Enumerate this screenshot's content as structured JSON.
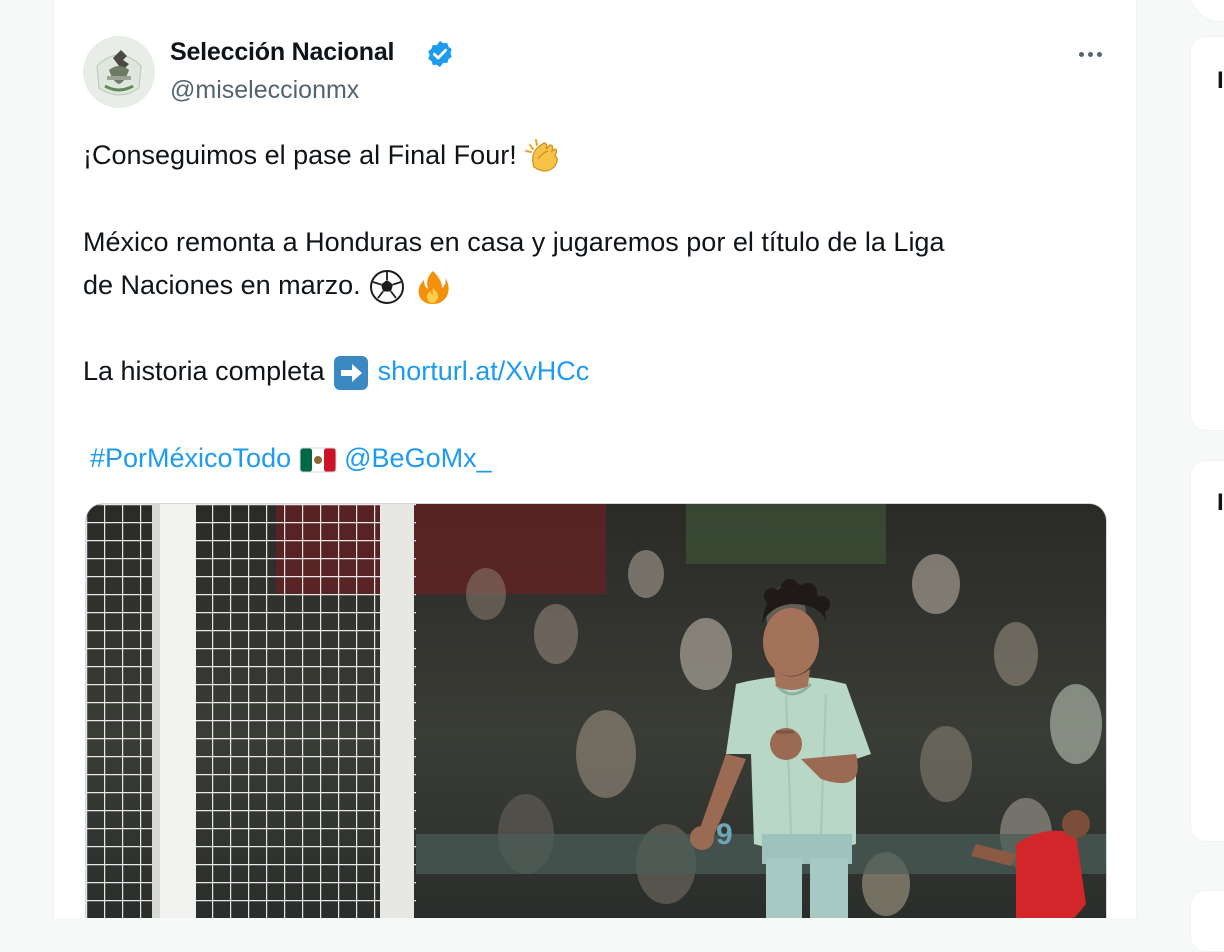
{
  "tweet": {
    "author_name": "Selección Nacional",
    "handle": "@miseleccionmx",
    "lines": {
      "line1": "¡Conseguimos el pase al Final Four!",
      "line2a": "México remonta a Honduras en casa y jugaremos por el título de la Liga",
      "line2b": "de Naciones en marzo.",
      "line4": "La historia completa",
      "link": "shorturl.at/XvHCc",
      "hashtag": "#PorMéxicoTodo",
      "mention": "@BeGoMx_"
    },
    "emojis": {
      "clap": "clapping-hands",
      "ball": "soccer-ball",
      "fire": "fire",
      "arrow": "right-arrow-button",
      "flag": "mexico-flag"
    }
  },
  "colors": {
    "link": "#1d9bf0",
    "verified": "#1d9bf0",
    "text": "#0f1419",
    "secondary": "#536471"
  },
  "media": {
    "description_icon": "photo"
  }
}
